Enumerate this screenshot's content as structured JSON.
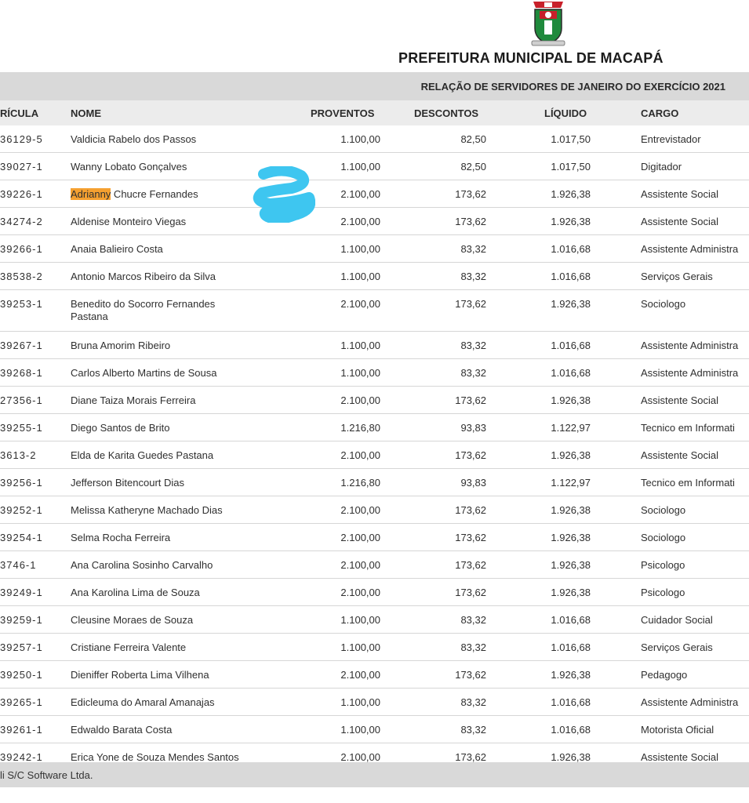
{
  "header": {
    "org_title": "PREFEITURA MUNICIPAL DE MACAPÁ",
    "report_title": "RELAÇÃO DE SERVIDORES DE JANEIRO DO EXERCÍCIO 2021"
  },
  "columns": {
    "matricula": "RÍCULA",
    "nome": "NOME",
    "proventos": "PROVENTOS",
    "descontos": "DESCONTOS",
    "liquido": "LÍQUIDO",
    "cargo": "CARGO"
  },
  "rows": [
    {
      "mat": "36129-5",
      "nome": "Valdicia Rabelo dos Passos",
      "prov": "1.100,00",
      "desc": "82,50",
      "liq": "1.017,50",
      "cargo": "Entrevistador"
    },
    {
      "mat": "39027-1",
      "nome": "Wanny Lobato Gonçalves",
      "prov": "1.100,00",
      "desc": "82,50",
      "liq": "1.017,50",
      "cargo": "Digitador"
    },
    {
      "mat": "39226-1",
      "nome_hl": "Adrianny",
      "nome_rest": " Chucre Fernandes",
      "prov": "2.100,00",
      "desc": "173,62",
      "liq": "1.926,38",
      "cargo": "Assistente Social"
    },
    {
      "mat": "34274-2",
      "nome": "Aldenise Monteiro Viegas",
      "prov": "2.100,00",
      "desc": "173,62",
      "liq": "1.926,38",
      "cargo": "Assistente Social"
    },
    {
      "mat": "39266-1",
      "nome": "Anaia Balieiro Costa",
      "prov": "1.100,00",
      "desc": "83,32",
      "liq": "1.016,68",
      "cargo": "Assistente Administra"
    },
    {
      "mat": "38538-2",
      "nome": "Antonio Marcos Ribeiro da Silva",
      "prov": "1.100,00",
      "desc": "83,32",
      "liq": "1.016,68",
      "cargo": "Serviços Gerais"
    },
    {
      "mat": "39253-1",
      "nome": "Benedito do Socorro Fernandes Pastana",
      "prov": "2.100,00",
      "desc": "173,62",
      "liq": "1.926,38",
      "cargo": "Sociologo"
    },
    {
      "mat": "39267-1",
      "nome": "Bruna Amorim Ribeiro",
      "prov": "1.100,00",
      "desc": "83,32",
      "liq": "1.016,68",
      "cargo": "Assistente Administra"
    },
    {
      "mat": "39268-1",
      "nome": "Carlos Alberto Martins de Sousa",
      "prov": "1.100,00",
      "desc": "83,32",
      "liq": "1.016,68",
      "cargo": "Assistente Administra"
    },
    {
      "mat": "27356-1",
      "nome": "Diane Taiza Morais Ferreira",
      "prov": "2.100,00",
      "desc": "173,62",
      "liq": "1.926,38",
      "cargo": "Assistente Social"
    },
    {
      "mat": "39255-1",
      "nome": "Diego Santos de Brito",
      "prov": "1.216,80",
      "desc": "93,83",
      "liq": "1.122,97",
      "cargo": "Tecnico em Informati"
    },
    {
      "mat": "3613-2",
      "nome": "Elda de Karita Guedes Pastana",
      "prov": "2.100,00",
      "desc": "173,62",
      "liq": "1.926,38",
      "cargo": "Assistente Social"
    },
    {
      "mat": "39256-1",
      "nome": "Jefferson Bitencourt Dias",
      "prov": "1.216,80",
      "desc": "93,83",
      "liq": "1.122,97",
      "cargo": "Tecnico em Informati"
    },
    {
      "mat": "39252-1",
      "nome": "Melissa Katheryne Machado Dias",
      "prov": "2.100,00",
      "desc": "173,62",
      "liq": "1.926,38",
      "cargo": "Sociologo"
    },
    {
      "mat": "39254-1",
      "nome": "Selma Rocha Ferreira",
      "prov": "2.100,00",
      "desc": "173,62",
      "liq": "1.926,38",
      "cargo": "Sociologo"
    },
    {
      "mat": "3746-1",
      "nome": "Ana Carolina Sosinho Carvalho",
      "prov": "2.100,00",
      "desc": "173,62",
      "liq": "1.926,38",
      "cargo": "Psicologo"
    },
    {
      "mat": "39249-1",
      "nome": "Ana Karolina Lima de Souza",
      "prov": "2.100,00",
      "desc": "173,62",
      "liq": "1.926,38",
      "cargo": "Psicologo"
    },
    {
      "mat": "39259-1",
      "nome": "Cleusine Moraes de Souza",
      "prov": "1.100,00",
      "desc": "83,32",
      "liq": "1.016,68",
      "cargo": "Cuidador Social"
    },
    {
      "mat": "39257-1",
      "nome": "Cristiane Ferreira Valente",
      "prov": "1.100,00",
      "desc": "83,32",
      "liq": "1.016,68",
      "cargo": "Serviços Gerais"
    },
    {
      "mat": "39250-1",
      "nome": "Dieniffer Roberta Lima Vilhena",
      "prov": "2.100,00",
      "desc": "173,62",
      "liq": "1.926,38",
      "cargo": "Pedagogo"
    },
    {
      "mat": "39265-1",
      "nome": "Edicleuma do Amaral Amanajas",
      "prov": "1.100,00",
      "desc": "83,32",
      "liq": "1.016,68",
      "cargo": "Assistente Administra"
    },
    {
      "mat": "39261-1",
      "nome": "Edwaldo Barata Costa",
      "prov": "1.100,00",
      "desc": "83,32",
      "liq": "1.016,68",
      "cargo": "Motorista Oficial"
    },
    {
      "mat": "39242-1",
      "nome": "Erica Yone de Souza Mendes Santos",
      "prov": "2.100,00",
      "desc": "173,62",
      "liq": "1.926,38",
      "cargo": "Assistente Social"
    }
  ],
  "footer": {
    "text": "li S/C Software Ltda."
  },
  "colors": {
    "band": "#d9d9d9",
    "highlight": "#f5a030",
    "blot": "#3ec6f0",
    "crest_red": "#c8202a",
    "crest_green": "#1f8a3c"
  }
}
